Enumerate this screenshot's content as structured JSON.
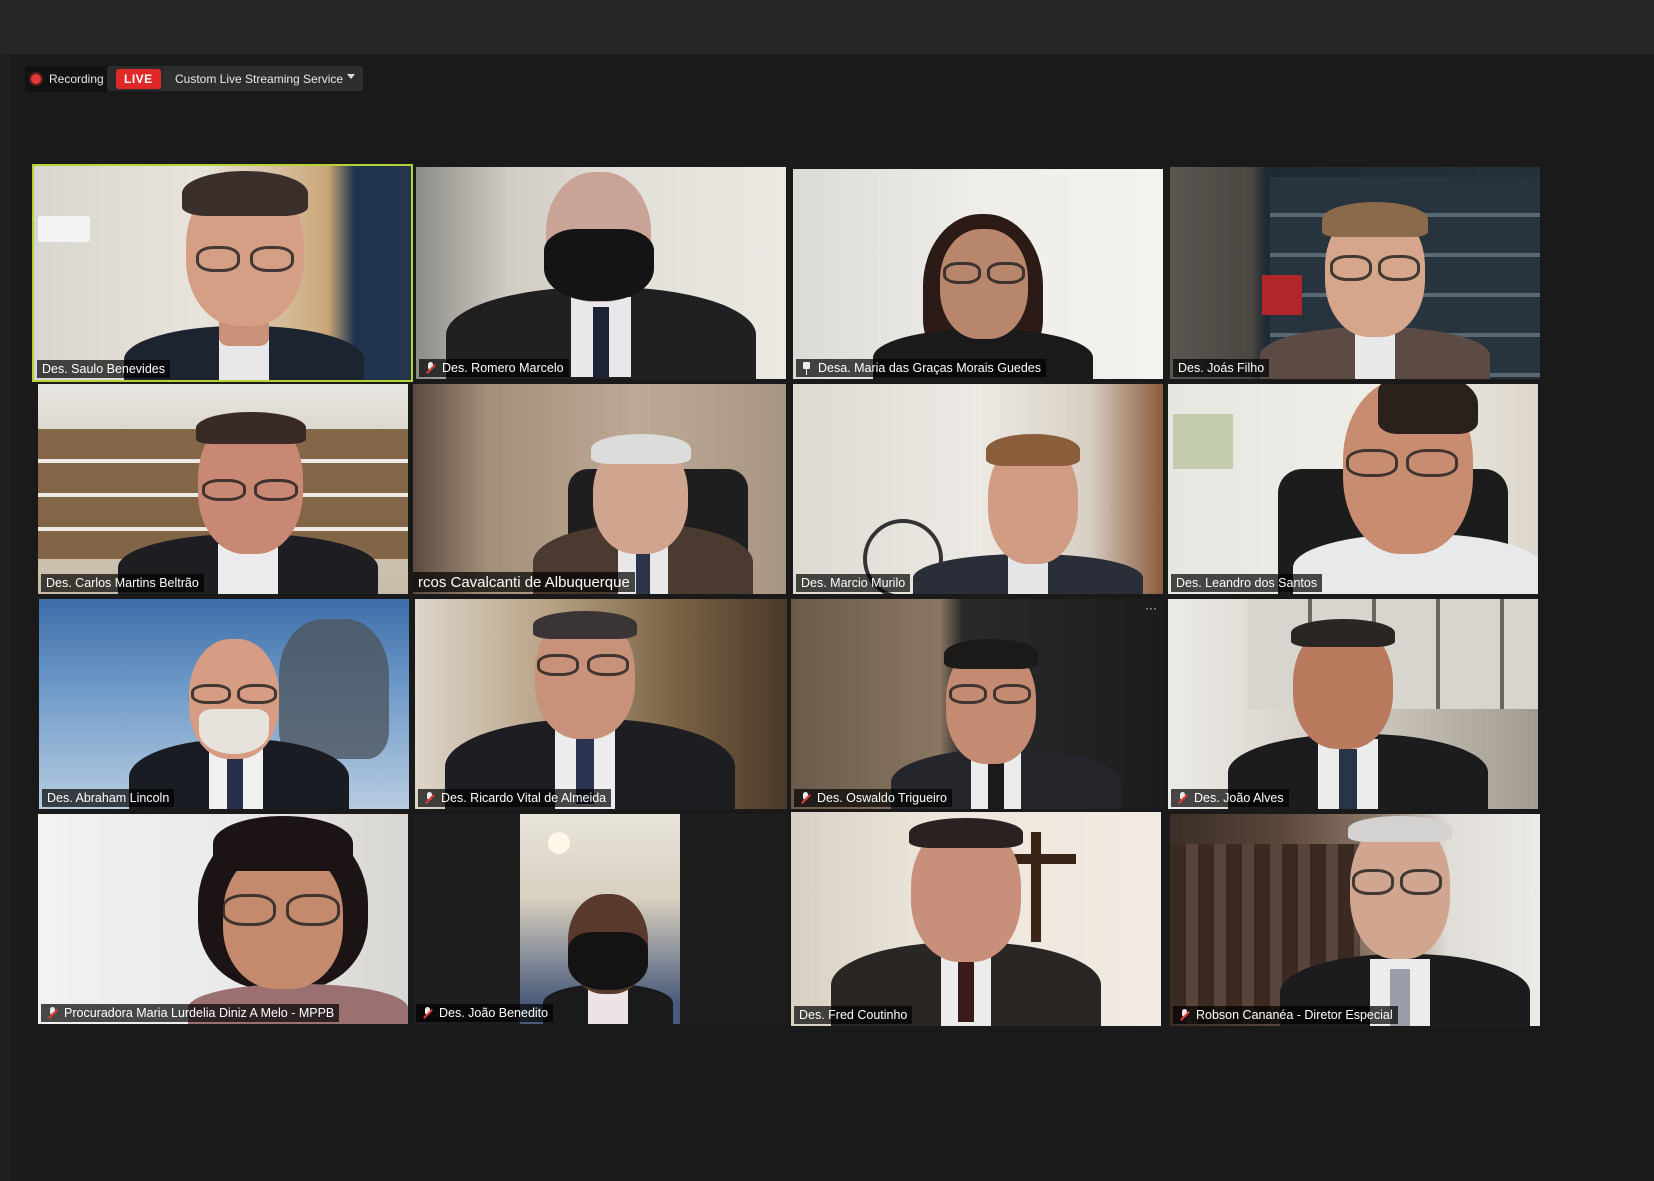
{
  "toolbar": {
    "recording_label": "Recording",
    "live_label": "LIVE",
    "stream_service": "Custom Live Streaming Service"
  },
  "participants": [
    {
      "name": "Des. Saulo Benevides",
      "muted": false,
      "active_speaker": true
    },
    {
      "name": "Des. Romero Marcelo",
      "muted": true
    },
    {
      "name": "Desa. Maria das Graças Morais Guedes",
      "muted": false,
      "pinned": true
    },
    {
      "name": "Des. Joás Filho",
      "muted": false
    },
    {
      "name": "Des. Carlos Martins Beltrão",
      "muted": false
    },
    {
      "name": "rcos Cavalcanti de Albuquerque",
      "muted": false
    },
    {
      "name": "Des. Marcio Murilo",
      "muted": false
    },
    {
      "name": "Des. Leandro dos Santos",
      "muted": false
    },
    {
      "name": "Des. Abraham Lincoln",
      "muted": false
    },
    {
      "name": "Des. Ricardo Vital de Almeida",
      "muted": true
    },
    {
      "name": "Des. Oswaldo Trigueiro",
      "muted": true
    },
    {
      "name": "Des. João Alves",
      "muted": true
    },
    {
      "name": "Procuradora Maria Lurdelia Diniz A Melo - MPPB",
      "muted": true
    },
    {
      "name": "Des. João Benedito",
      "muted": true
    },
    {
      "name": "Des. Fred Coutinho",
      "muted": false
    },
    {
      "name": "Robson Cananéa - Diretor Especial",
      "muted": true
    }
  ],
  "more_options": "···",
  "colors": {
    "active_border": "#b5d334",
    "live_red": "#e02828",
    "muted_red": "#e23b3b"
  }
}
